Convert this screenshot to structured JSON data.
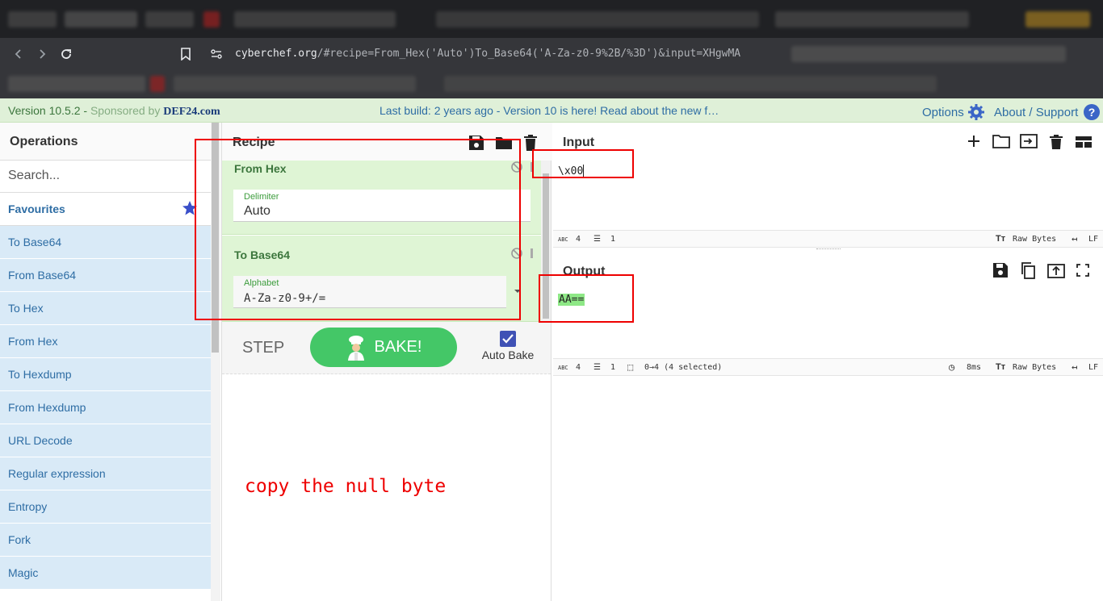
{
  "browser": {
    "url": "cyberchef.org/#recipe=From_Hex('Auto')To_Base64('A-Za-z0-9%2B/%3D')&input=XHgwMA",
    "url_host": "cyberchef.org"
  },
  "banner": {
    "version": "Version 10.5.2 - ",
    "sponsored": "Sponsored by ",
    "sponsor": "DEF24.com",
    "build": "Last build: 2 years ago - Version 10 is here! Read about the new f…",
    "options": "Options",
    "about": "About / Support"
  },
  "operations": {
    "title": "Operations",
    "search_placeholder": "Search...",
    "favourites": "Favourites",
    "items": [
      "To Base64",
      "From Base64",
      "To Hex",
      "From Hex",
      "To Hexdump",
      "From Hexdump",
      "URL Decode",
      "Regular expression",
      "Entropy",
      "Fork",
      "Magic"
    ]
  },
  "recipe": {
    "title": "Recipe",
    "ops": [
      {
        "name": "From Hex",
        "arg_label": "Delimiter",
        "arg_value": "Auto"
      },
      {
        "name": "To Base64",
        "arg_label": "Alphabet",
        "arg_value": "A-Za-z0-9+/="
      }
    ],
    "step": "STEP",
    "bake": "BAKE!",
    "auto_bake": "Auto Bake",
    "auto_bake_checked": true
  },
  "annotation": "copy the null byte",
  "input": {
    "title": "Input",
    "text": "\\x00",
    "stats": {
      "chars": "4",
      "lines": "1",
      "encoding": "Raw Bytes",
      "eol": "LF"
    }
  },
  "output": {
    "title": "Output",
    "text": "AA==",
    "stats": {
      "chars": "4",
      "lines": "1",
      "selection": "0→4 (4 selected)",
      "time": "8ms",
      "encoding": "Raw Bytes",
      "eol": "LF"
    }
  },
  "colors": {
    "banner_bg": "#dff0d8",
    "op_item_bg": "#d9eaf7",
    "recipe_op_bg": "#dff5d5",
    "bake_green": "#44c767",
    "annotation_red": "#ee0000"
  }
}
